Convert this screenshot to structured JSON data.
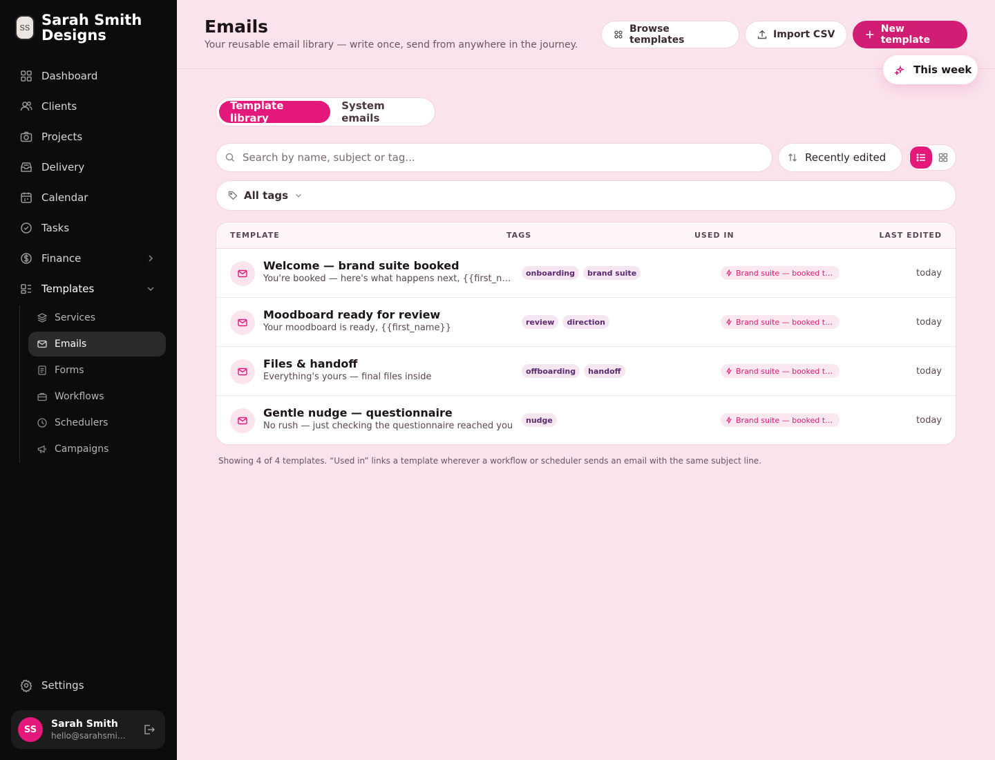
{
  "brand": {
    "logo": "SS",
    "name": "Sarah Smith Designs"
  },
  "nav": [
    {
      "label": "Dashboard",
      "icon": "dashboard-icon"
    },
    {
      "label": "Clients",
      "icon": "users-icon"
    },
    {
      "label": "Projects",
      "icon": "camera-icon"
    },
    {
      "label": "Delivery",
      "icon": "inbox-icon"
    },
    {
      "label": "Calendar",
      "icon": "calendar-icon"
    },
    {
      "label": "Tasks",
      "icon": "check-circle-icon"
    },
    {
      "label": "Finance",
      "icon": "dollar-icon"
    },
    {
      "label": "Templates",
      "icon": "templates-icon"
    }
  ],
  "subnav": [
    {
      "label": "Services",
      "icon": "layers-icon"
    },
    {
      "label": "Emails",
      "icon": "mail-icon"
    },
    {
      "label": "Forms",
      "icon": "form-icon"
    },
    {
      "label": "Workflows",
      "icon": "briefcase-icon"
    },
    {
      "label": "Schedulers",
      "icon": "clock-icon"
    },
    {
      "label": "Campaigns",
      "icon": "megaphone-icon"
    }
  ],
  "settings": {
    "label": "Settings"
  },
  "user": {
    "initials": "SS",
    "name": "Sarah Smith",
    "email": "hello@sarahsmithdesigns.com"
  },
  "header": {
    "title": "Emails",
    "subtitle": "Your reusable email library — write once, send from anywhere in the journey.",
    "browse_label": "Browse templates",
    "import_label": "Import CSV",
    "new_label": "New template",
    "week_label": "This week"
  },
  "tabs": {
    "library": "Template library",
    "system": "System emails"
  },
  "search": {
    "placeholder": "Search by name, subject or tag..."
  },
  "sort": {
    "label": "Recently edited"
  },
  "tags_filter": {
    "label": "All tags"
  },
  "table": {
    "columns": {
      "template": "TEMPLATE",
      "tags": "TAGS",
      "used_in": "USED IN",
      "last_edited": "LAST EDITED"
    },
    "rows": [
      {
        "title": "Welcome — brand suite booked",
        "subject": "You're booked — here's what happens next, {{first_name}}",
        "tags": [
          "onboarding",
          "brand suite"
        ],
        "used_in": "Brand suite — booked to handoff",
        "edited": "today"
      },
      {
        "title": "Moodboard ready for review",
        "subject": "Your moodboard is ready, {{first_name}}",
        "tags": [
          "review",
          "direction"
        ],
        "used_in": "Brand suite — booked to handoff",
        "edited": "today"
      },
      {
        "title": "Files & handoff",
        "subject": "Everything's yours — final files inside",
        "tags": [
          "offboarding",
          "handoff"
        ],
        "used_in": "Brand suite — booked to handoff",
        "edited": "today"
      },
      {
        "title": "Gentle nudge — questionnaire",
        "subject": "No rush — just checking the questionnaire reached you",
        "tags": [
          "nudge"
        ],
        "used_in": "Brand suite — booked to handoff",
        "edited": "today"
      }
    ]
  },
  "footer_note": "Showing 4 of 4 templates. “Used in” links a template wherever a workflow or scheduler sends an email with the same subject line.",
  "colors": {
    "accent": "#e3187a",
    "sidebar_bg": "#0c0c0c",
    "page_bg": "#fae3ec"
  }
}
